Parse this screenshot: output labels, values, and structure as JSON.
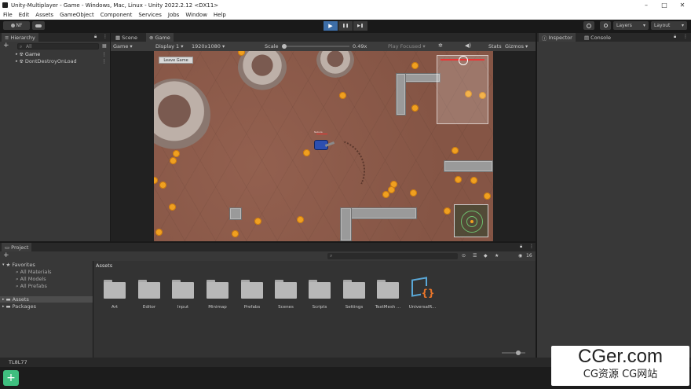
{
  "window": {
    "title": "Unity-Multiplayer - Game - Windows, Mac, Linux - Unity 2022.2.12 <DX11>",
    "controls": [
      "–",
      "□",
      "✕"
    ]
  },
  "menu": [
    "File",
    "Edit",
    "Assets",
    "GameObject",
    "Component",
    "Services",
    "Jobs",
    "Window",
    "Help"
  ],
  "toolbar": {
    "account": "NF",
    "layers_label": "Layers",
    "layout_label": "Layout",
    "play": "▶",
    "pause": "❚❚",
    "step": "▶❚"
  },
  "hierarchy": {
    "tab": "Hierarchy",
    "search_placeholder": "All",
    "add": "+",
    "items": [
      "Game",
      "DontDestroyOnLoad"
    ]
  },
  "scene_tabs": [
    "Scene",
    "Game"
  ],
  "game_bar": {
    "mode": "Game",
    "display": "Display 1",
    "resolution": "1920x1080",
    "scale_label": "Scale",
    "scale_value": "0.49x",
    "play_focused": "Play Focused",
    "stats": "Stats",
    "gizmos": "Gizmos"
  },
  "game_view": {
    "leave_button": "Leave Game",
    "player_tag": "Nebula"
  },
  "inspector": {
    "tabs": [
      "Inspector",
      "Console"
    ]
  },
  "project": {
    "tab": "Project",
    "add": "+",
    "favorites": "Favorites",
    "fav_items": [
      "All Materials",
      "All Models",
      "All Prefabs"
    ],
    "assets": "Assets",
    "packages": "Packages",
    "breadcrumb": "Assets",
    "hidden_count": "16",
    "folders": [
      "Art",
      "Editor",
      "Input",
      "Minimap",
      "Prefabs",
      "Scenes",
      "Scripts",
      "Settings",
      "TextMesh ...",
      "UniversalR..."
    ]
  },
  "status": {
    "code": "TL8L77"
  },
  "watermark": {
    "site": "CGer.com",
    "sub": "CG资源 CG网站"
  },
  "colors": {
    "accent": "#3d6ea8",
    "coin": "#f0a020",
    "ground": "#8b5a4a"
  }
}
